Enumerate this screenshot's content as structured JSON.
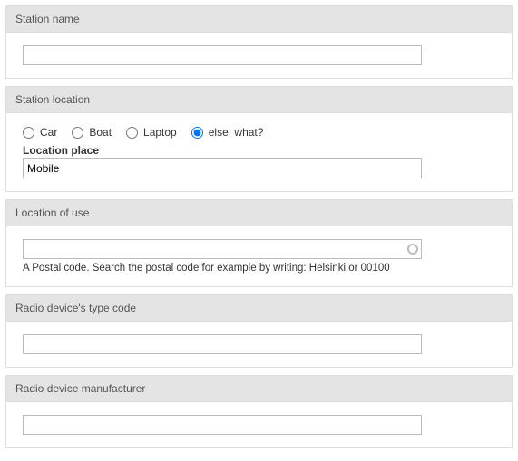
{
  "sections": {
    "station_name": {
      "title": "Station name",
      "value": ""
    },
    "station_location": {
      "title": "Station location",
      "options": {
        "car": "Car",
        "boat": "Boat",
        "laptop": "Laptop",
        "else": "else, what?"
      },
      "selected": "else",
      "place_label": "Location place",
      "place_value": "Mobile"
    },
    "location_of_use": {
      "title": "Location of use",
      "value": "",
      "helper": "A Postal code. Search the postal code for example by writing: Helsinki or 00100"
    },
    "type_code": {
      "title": "Radio device's type code",
      "value": ""
    },
    "manufacturer": {
      "title": "Radio device manufacturer",
      "value": ""
    }
  }
}
